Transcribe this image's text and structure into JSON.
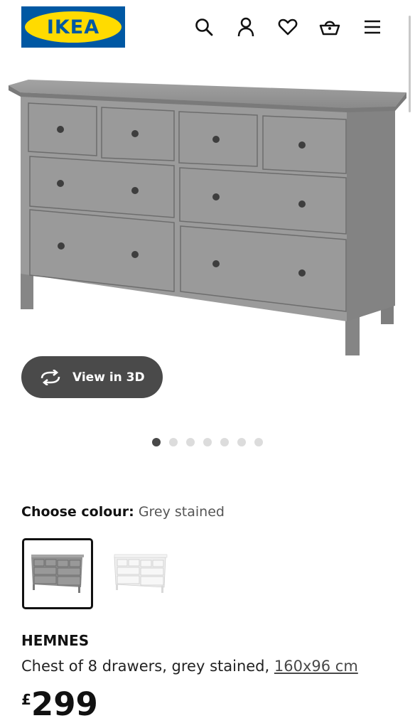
{
  "header": {
    "logo_text": "IKEA",
    "icons": [
      "search-icon",
      "user-icon",
      "heart-icon",
      "basket-icon",
      "menu-icon"
    ]
  },
  "product": {
    "view_3d_label": "View in 3D",
    "carousel": {
      "total_images": 7,
      "active_index": 0
    },
    "colour_label": "Choose colour:",
    "colour_value": "Grey stained",
    "swatches": [
      {
        "name": "Grey stained",
        "selected": true
      },
      {
        "name": "White stain",
        "selected": false
      }
    ],
    "name": "HEMNES",
    "description": "Chest of 8 drawers, grey stained, ",
    "dimensions": "160x96 cm",
    "currency": "£",
    "price": "299"
  },
  "colors": {
    "brand_blue": "#0058a3",
    "brand_yellow": "#ffdb00",
    "furniture_grey": "#8e8e8e"
  }
}
